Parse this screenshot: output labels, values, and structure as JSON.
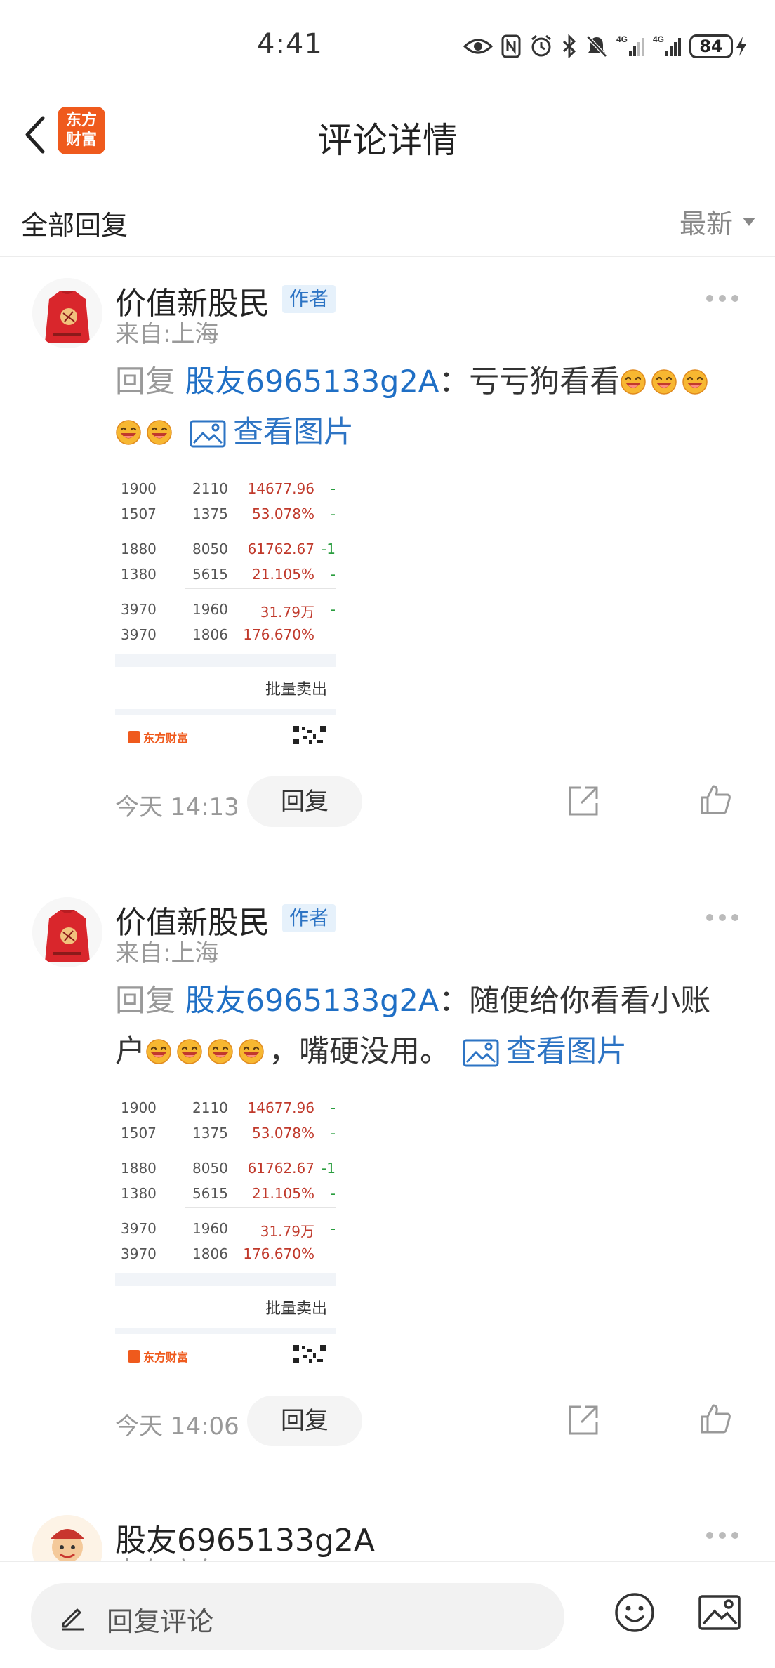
{
  "status_bar": {
    "time": "4:41",
    "battery": "84"
  },
  "header": {
    "title": "评论详情",
    "logo_line1": "东方",
    "logo_line2": "财富"
  },
  "filter": {
    "all_label": "全部回复",
    "sort_label": "最新"
  },
  "comments": [
    {
      "author": "价值新股民",
      "badge": "作者",
      "location": "来自:上海",
      "reply_prefix": "回复",
      "reply_user": "股友6965133g2A",
      "text_before": "：亏亏狗看看",
      "text_after": "",
      "emoji_count": 5,
      "view_image": "查看图片",
      "time": "今天 14:13",
      "reply_button": "回复"
    },
    {
      "author": "价值新股民",
      "badge": "作者",
      "location": "来自:上海",
      "reply_prefix": "回复",
      "reply_user": "股友6965133g2A",
      "text_before": "：随便给你看看小账户",
      "text_after": "，嘴硬没用。",
      "emoji_count": 4,
      "view_image": "查看图片",
      "time": "今天 14:06",
      "reply_button": "回复"
    },
    {
      "author": "股友6965133g2A",
      "location": "来自:广东"
    }
  ],
  "thumbnail": {
    "rows": [
      {
        "c1": "1900",
        "c2": "2110",
        "c3": "14677.96",
        "c4": "-"
      },
      {
        "c1": "1507",
        "c2": "1375",
        "c3": "53.078%",
        "c4": "-"
      },
      {
        "c1": "1880",
        "c2": "8050",
        "c3": "61762.67",
        "c4": "-1"
      },
      {
        "c1": "1380",
        "c2": "5615",
        "c3": "21.105%",
        "c4": "-"
      },
      {
        "c1": "3970",
        "c2": "1960",
        "c3": "31.79万",
        "c4": "-"
      },
      {
        "c1": "3970",
        "c2": "1806",
        "c3": "176.670%",
        "c4": ""
      }
    ],
    "sell_label": "批量卖出",
    "logo_label": "东方财富"
  },
  "bottom_bar": {
    "reply_placeholder": "回复评论"
  },
  "colors": {
    "brand": "#ef5a1d",
    "link": "#1f6fc5",
    "badge_bg": "#e6f1fb"
  }
}
